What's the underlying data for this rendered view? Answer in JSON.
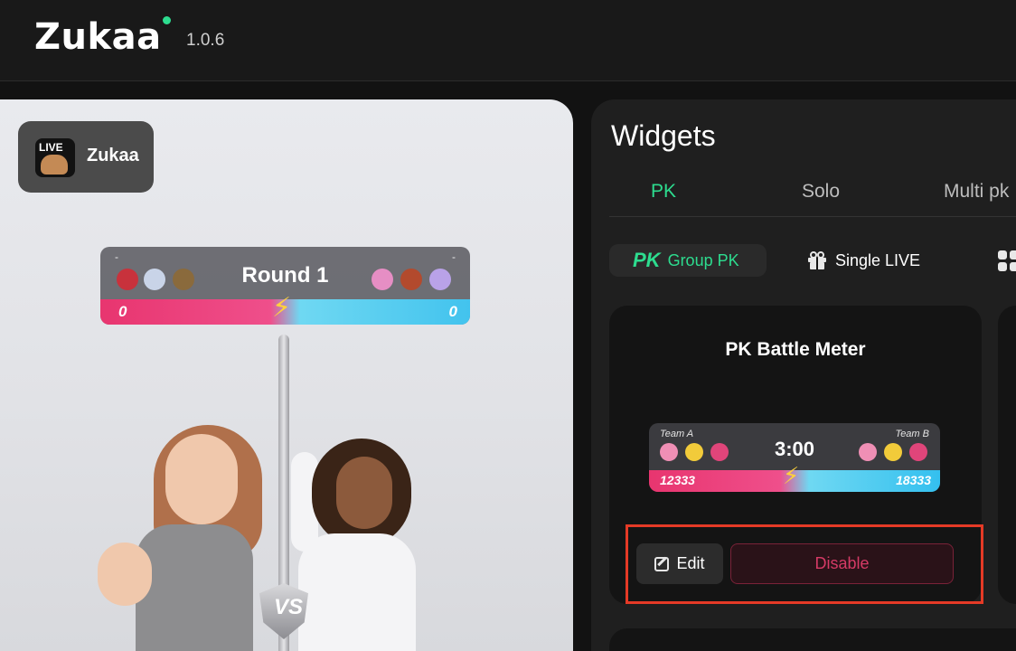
{
  "app": {
    "name": "Zukaa",
    "version": "1.0.6",
    "accent_color": "#2ddc8f",
    "status_dot": "online-dot"
  },
  "preview": {
    "live_badge": {
      "icon_text": "LIVE",
      "name": "Zukaa"
    },
    "pk_meter": {
      "round_label": "Round 1",
      "left_dash": "-",
      "right_dash": "-",
      "left_score": "0",
      "right_score": "0",
      "left_gifts": [
        "rose-icon",
        "heart-gem-icon",
        "teddy-icon"
      ],
      "right_gifts": [
        "flower-icon",
        "treasure-icon",
        "music-note-icon"
      ],
      "vs_text": "VS"
    }
  },
  "widgets": {
    "title": "Widgets",
    "tabs": [
      {
        "label": "PK",
        "active": true
      },
      {
        "label": "Solo",
        "active": false
      },
      {
        "label": "Multi pk",
        "active": false
      }
    ],
    "chips": [
      {
        "icon_text": "PK",
        "label": "Group PK",
        "active": true
      },
      {
        "label": "Single LIVE",
        "active": false
      }
    ],
    "card": {
      "title": "PK Battle Meter",
      "preview": {
        "team_a": "Team A",
        "team_b": "Team B",
        "timer": "3:00",
        "score_a": "12333",
        "score_b": "18333"
      },
      "edit_label": "Edit",
      "disable_label": "Disable"
    }
  }
}
